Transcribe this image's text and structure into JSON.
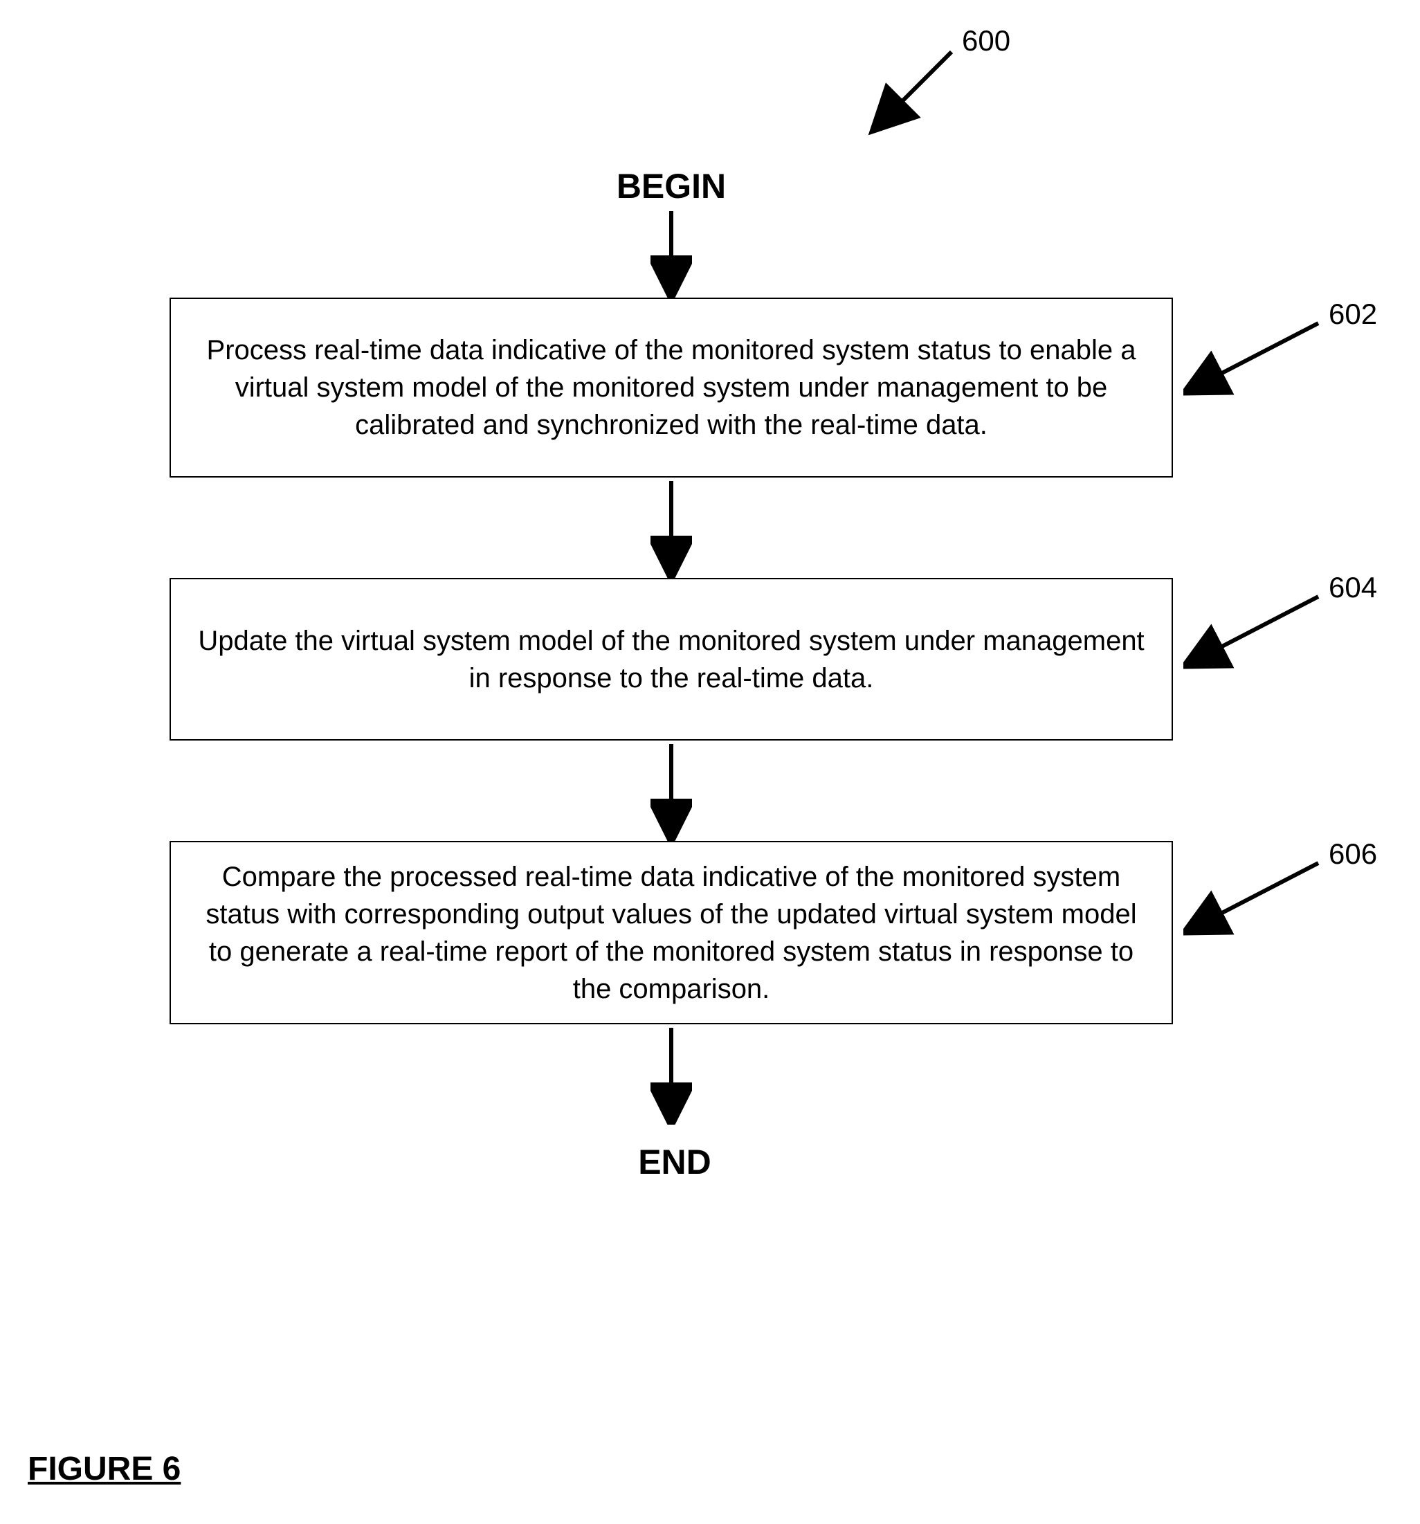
{
  "diagram": {
    "ref_main": "600",
    "begin": "BEGIN",
    "end": "END",
    "box1": {
      "text": "Process real-time data indicative of the monitored system status to enable a virtual system model of the monitored system under management to be calibrated and synchronized with the real-time data.",
      "ref": "602"
    },
    "box2": {
      "text": "Update the virtual system model of the monitored system under management in response to the real-time data.",
      "ref": "604"
    },
    "box3": {
      "text": "Compare the processed real-time data indicative of the monitored system status with corresponding output values of the updated virtual system model to generate a real-time report of the monitored system status in response to the comparison.",
      "ref": "606"
    },
    "figure": "FIGURE 6"
  }
}
